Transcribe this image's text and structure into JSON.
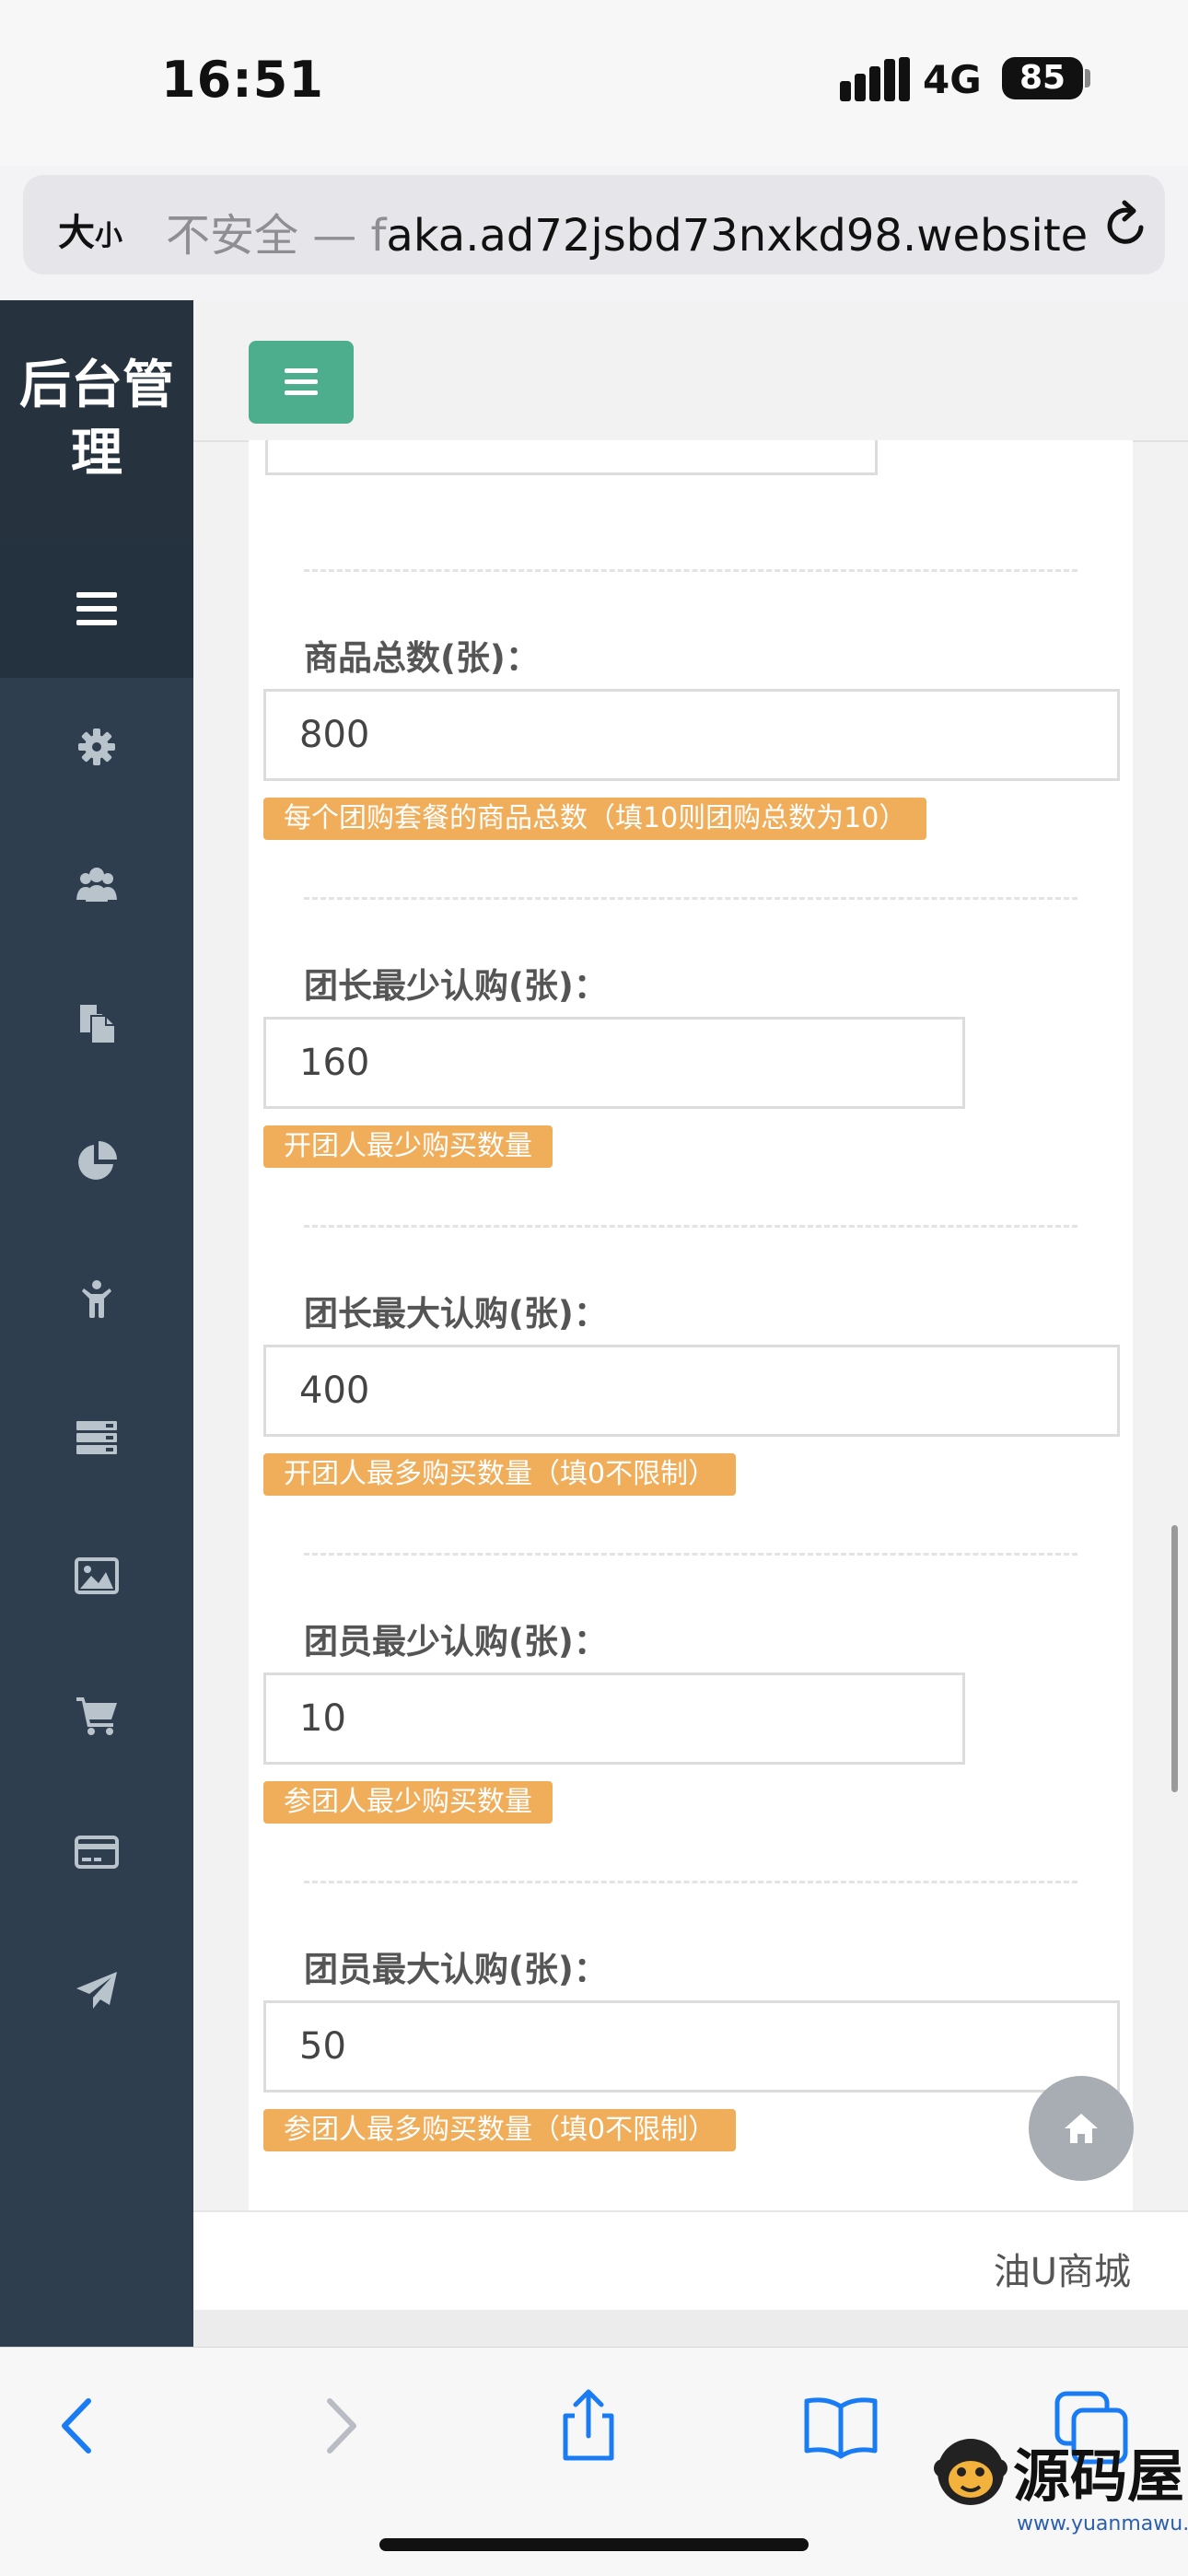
{
  "status_bar": {
    "time": "16:51",
    "network": "4G",
    "battery": "85"
  },
  "browser": {
    "aa_label": "大",
    "aa_small": "小",
    "insecure_label": "不安全 — f",
    "url": "aka.ad72jsbd73nxkd98.website"
  },
  "sidebar": {
    "brand": "后台管理",
    "items": [
      {
        "icon": "gear-icon"
      },
      {
        "icon": "users-icon"
      },
      {
        "icon": "documents-icon"
      },
      {
        "icon": "pie-chart-icon"
      },
      {
        "icon": "child-icon"
      },
      {
        "icon": "server-icon"
      },
      {
        "icon": "image-icon"
      },
      {
        "icon": "cart-icon"
      },
      {
        "icon": "credit-card-icon"
      },
      {
        "icon": "paper-plane-icon"
      }
    ]
  },
  "form": {
    "fields": [
      {
        "label": "商品总数(张)：",
        "value": "800",
        "hint": "每个团购套餐的商品总数（填10则团购总数为10）"
      },
      {
        "label": "团长最少认购(张)：",
        "value": "160",
        "hint": "开团人最少购买数量"
      },
      {
        "label": "团长最大认购(张)：",
        "value": "400",
        "hint": "开团人最多购买数量（填0不限制）"
      },
      {
        "label": "团员最少认购(张)：",
        "value": "10",
        "hint": "参团人最少购买数量"
      },
      {
        "label": "团员最大认购(张)：",
        "value": "50",
        "hint": "参团人最多购买数量（填0不限制）"
      }
    ]
  },
  "footer": {
    "text": "油U商城"
  },
  "watermark": {
    "text": "源码屋",
    "sub": "www.yuanmawu.net"
  },
  "colors": {
    "sidebar": "#2e3e4e",
    "accent": "#4cae8c",
    "hint": "#f0ad5a",
    "ios_blue": "#1a7cf5"
  }
}
